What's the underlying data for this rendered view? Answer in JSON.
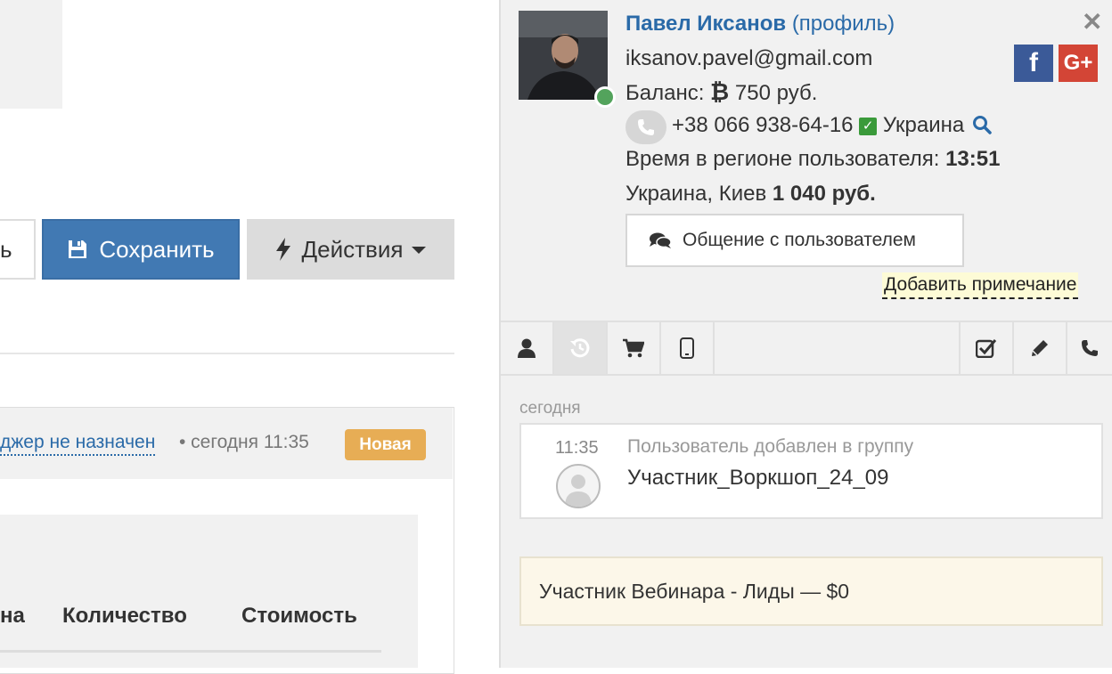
{
  "left": {
    "left_button_label": "ь",
    "save_button": "Сохранить",
    "actions_button": "Действия",
    "order": {
      "manager": "джер не назначен",
      "meta": "• сегодня 11:35",
      "status_badge": "Новая"
    },
    "table_headers": [
      "на",
      "Количество",
      "Стоимость"
    ]
  },
  "user": {
    "name": "Павел Иксанов",
    "profile_link": "(профиль)",
    "email": "iksanov.pavel@gmail.com",
    "balance_label": "Баланс:",
    "balance_value": "750 руб.",
    "phone": "+38 066 938-64-16",
    "country": "Украина",
    "region_time_label": "Время в регионе пользователя:",
    "region_time": "13:51",
    "location": "Украина, Киев",
    "location_amount": "1 040 руб.",
    "chat_button": "Общение с пользователем",
    "add_note": "Добавить примечание"
  },
  "social": {
    "facebook": "f",
    "google": "G+"
  },
  "tabs": [
    {
      "icon": "user-icon",
      "active": false
    },
    {
      "icon": "history-icon",
      "active": true
    },
    {
      "icon": "cart-icon",
      "active": false
    },
    {
      "icon": "mobile-icon",
      "active": false
    },
    {
      "icon": "checkbox-icon",
      "active": false
    },
    {
      "icon": "pencil-icon",
      "active": false
    },
    {
      "icon": "phone-icon",
      "active": false
    }
  ],
  "timeline": {
    "day_label": "сегодня",
    "event_time": "11:35",
    "event_title": "Пользователь добавлен в группу",
    "event_body": "Участник_Воркшоп_24_09"
  },
  "deal": "Участник Вебинара - Лиды — $0",
  "colors": {
    "primary": "#4179b3",
    "link": "#2a6aa8",
    "badge_new": "#e7ad55",
    "online": "#53a35c",
    "facebook": "#3b5a98",
    "google": "#d34536"
  }
}
